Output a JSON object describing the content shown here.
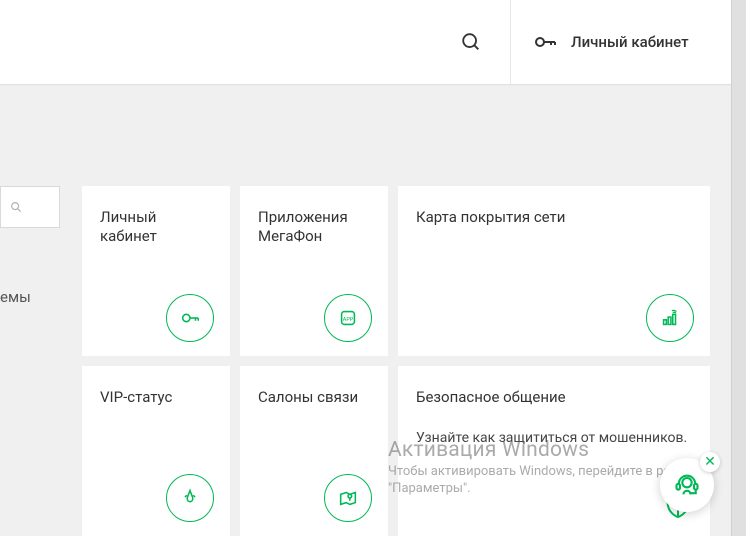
{
  "header": {
    "cabinet_label": "Личный кабинет"
  },
  "sidebar": {
    "filter_label": "емы"
  },
  "cards": {
    "cabinet": {
      "title": "Личный кабинет"
    },
    "apps": {
      "title": "Приложения МегаФон"
    },
    "coverage": {
      "title": "Карта покрытия сети"
    },
    "vip": {
      "title": "VIP-статус"
    },
    "stores": {
      "title": "Салоны связи"
    },
    "safe": {
      "title": "Безопасное общение",
      "sub": "Узнайте как защититься от мошенников."
    }
  },
  "watermark": {
    "title": "Активация Windows",
    "sub": "Чтобы активировать Windows, перейдите в раздел \"Параметры\"."
  }
}
